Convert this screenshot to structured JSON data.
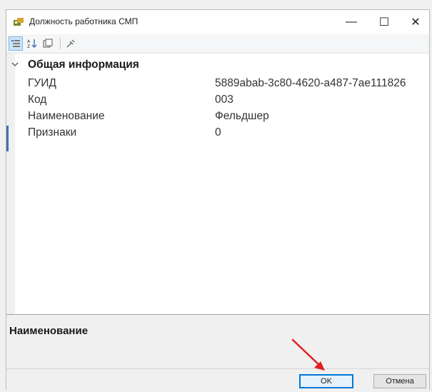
{
  "window": {
    "title": "Должность работника СМП",
    "minimize_glyph": "—",
    "maximize_glyph": "☐",
    "close_glyph": "✕"
  },
  "toolbar": {
    "buttons": [
      {
        "icon": "categorized-view-icon",
        "active": true
      },
      {
        "icon": "alphabetical-sort-icon",
        "active": false
      },
      {
        "icon": "property-pages-icon",
        "active": false
      },
      {
        "icon": "settings-icon",
        "active": false
      }
    ]
  },
  "property_grid": {
    "category": "Общая информация",
    "rows": [
      {
        "name": "ГУИД",
        "value": "5889abab-3c80-4620-a487-7ae111826"
      },
      {
        "name": "Код",
        "value": "003"
      },
      {
        "name": "Наименование",
        "value": "Фельдшер"
      },
      {
        "name": "Признаки",
        "value": "0"
      }
    ]
  },
  "description": {
    "title": "Наименование"
  },
  "footer": {
    "ok_label": "OK",
    "cancel_label": "Отмена"
  },
  "colors": {
    "accent": "#0078d7",
    "annotation_arrow": "#e02020"
  }
}
